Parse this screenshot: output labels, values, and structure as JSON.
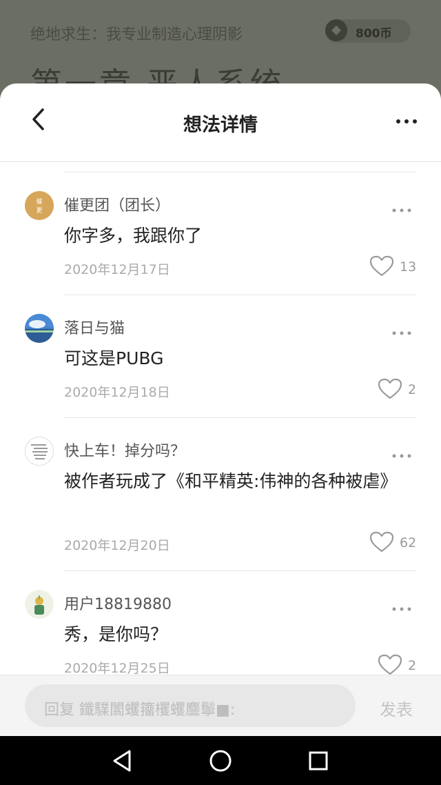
{
  "background": {
    "book_title": "绝地求生：我专业制造心理阴影",
    "coin_label": "800币",
    "chapter_title": "第一章 恶人系统"
  },
  "header": {
    "title": "想法详情"
  },
  "comments": [
    {
      "user": "催更团（团长）",
      "avatar_text": "催更",
      "text": "你字多，我跟你了",
      "date": "2020年12月17日",
      "likes": "13"
    },
    {
      "user": "落日与猫",
      "text": "可这是PUBG",
      "date": "2020年12月18日",
      "likes": "2"
    },
    {
      "user": "快上车！掉分吗？",
      "text": "被作者玩成了《和平精英:伟神的各种被虐》",
      "date": "2020年12月20日",
      "likes": "62"
    },
    {
      "user": "用户18819880",
      "text": "秀，是你吗？",
      "date": "2020年12月25日",
      "likes": "2"
    }
  ],
  "reply": {
    "placeholder": "回复 鑯驜闟蠼籒欔蠼麢鬡■:",
    "send_label": "发表"
  },
  "colors": {
    "accent_text": "#222222",
    "muted_text": "#aaaaaa",
    "overlay_background": "#6b6e64"
  }
}
